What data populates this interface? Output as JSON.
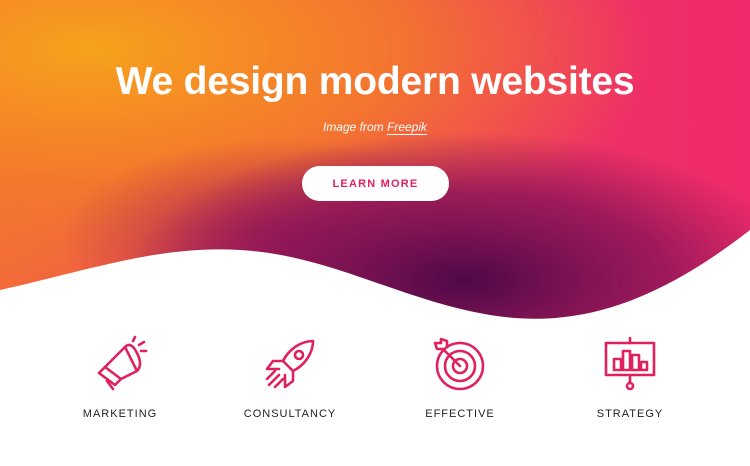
{
  "hero": {
    "title": "We design modern websites",
    "credit_prefix": "Image from",
    "credit_link": "Freepik",
    "cta_label": "LEARN MORE"
  },
  "features": [
    {
      "label": "MARKETING",
      "icon": "megaphone-icon"
    },
    {
      "label": "CONSULTANCY",
      "icon": "rocket-icon"
    },
    {
      "label": "EFFECTIVE",
      "icon": "target-icon"
    },
    {
      "label": "STRATEGY",
      "icon": "presentation-chart-icon"
    }
  ],
  "colors": {
    "accent": "#e0215f",
    "gradient_orange": "#f7a21c",
    "gradient_pink": "#ee2f6a",
    "gradient_purple": "#5a0a4a",
    "text_dark": "#222222"
  }
}
